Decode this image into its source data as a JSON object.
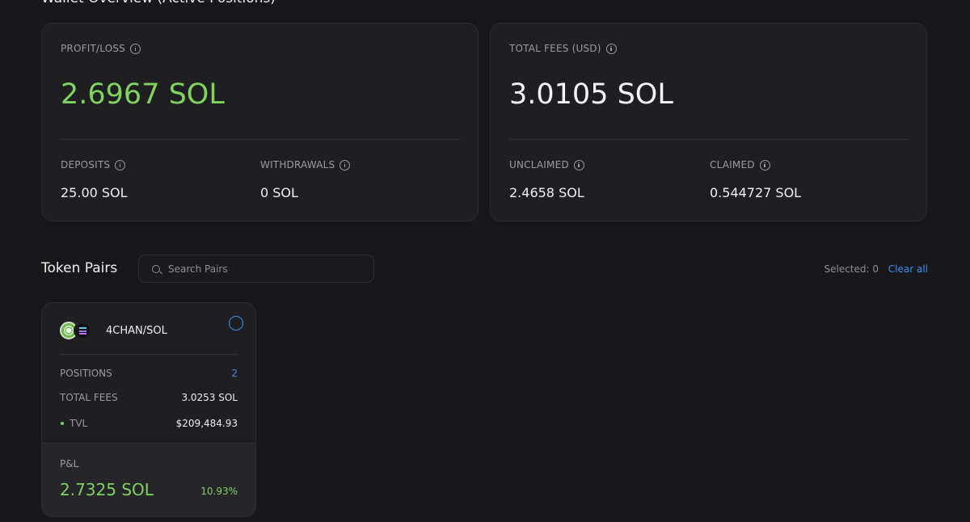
{
  "overview": {
    "title": "Wallet Overview (Active Positions)",
    "left_panel": {
      "profit_loss_label": "PROFIT/LOSS",
      "profit_loss_value": "2.6967 SOL",
      "deposits_label": "DEPOSITS",
      "deposits_value": "25.00 SOL",
      "withdrawals_label": "WITHDRAWALS",
      "withdrawals_value": "0 SOL"
    },
    "right_panel": {
      "total_fees_label": "TOTAL FEES (USD)",
      "total_fees_value": "3.0105 SOL",
      "unclaimed_label": "UNCLAIMED",
      "unclaimed_value": "2.4658 SOL",
      "claimed_label": "CLAIMED",
      "claimed_value": "0.544727 SOL"
    }
  },
  "token_pairs": {
    "title": "Token Pairs",
    "search_placeholder": "Search Pairs",
    "selected_text": "Selected: 0",
    "clear_all": "Clear all",
    "cards": [
      {
        "pair": "4CHAN/SOL",
        "positions_label": "POSITIONS",
        "positions_value": "2",
        "total_fees_label": "TOTAL FEES",
        "total_fees_value": "3.0253 SOL",
        "tvl_label": "TVL",
        "tvl_value": "$209,484.93",
        "pnl_label": "P&L",
        "pnl_value": "2.7325 SOL",
        "pnl_percent": "10.93%"
      }
    ]
  },
  "colors": {
    "background": "#18181a",
    "panel": "#1f1f22",
    "positive": "#7fd35e",
    "accent": "#3b8ff3"
  }
}
